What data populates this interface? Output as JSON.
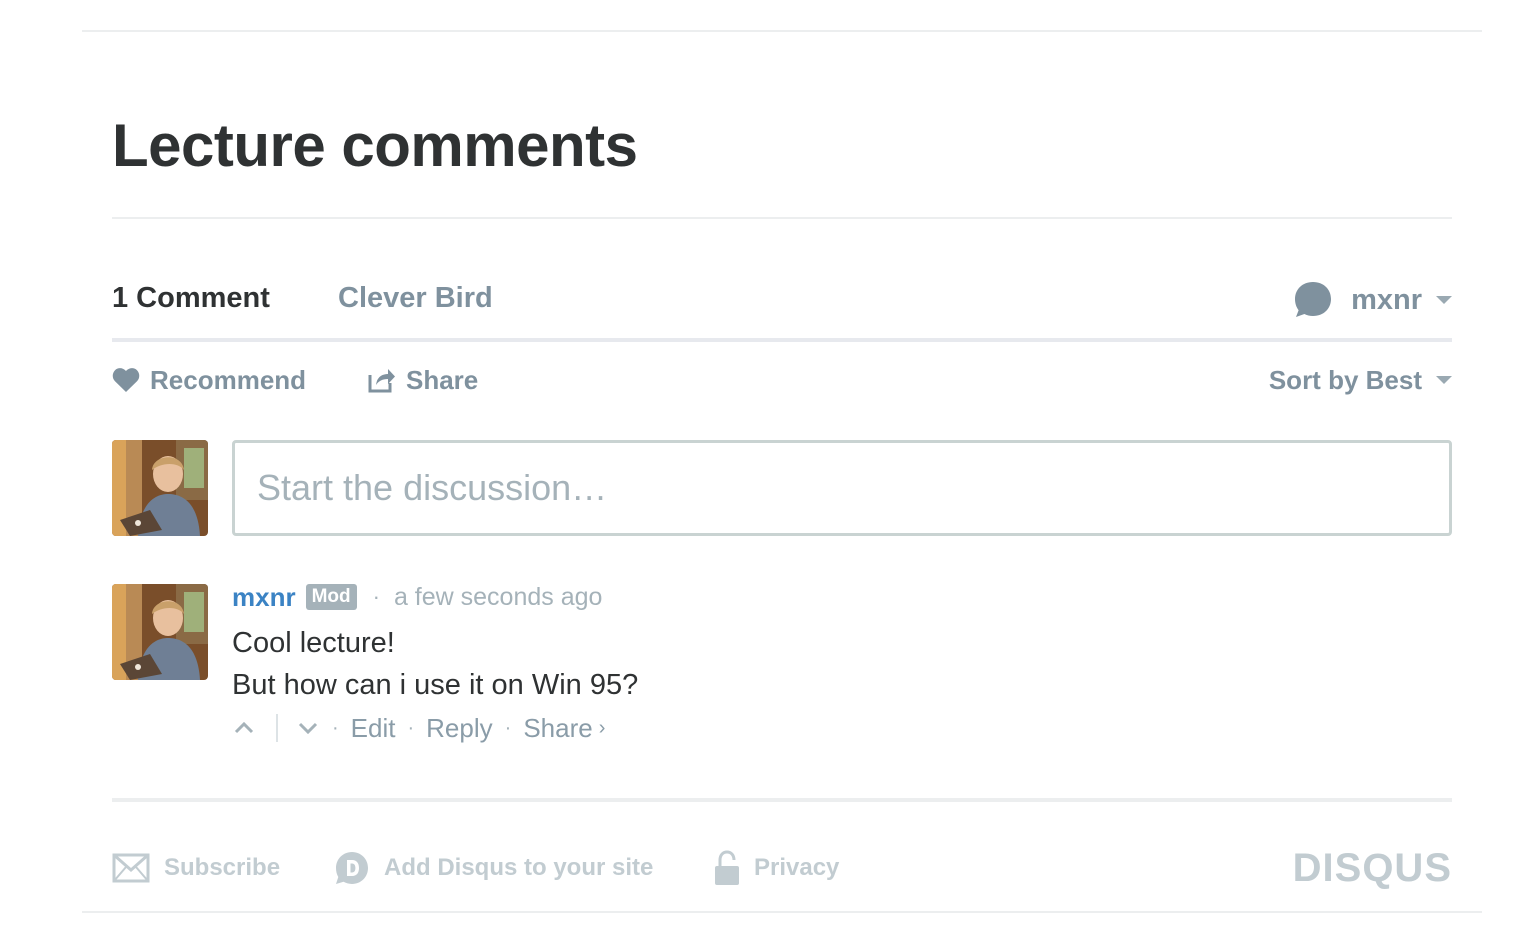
{
  "section_title": "Lecture comments",
  "tabs": {
    "comments_label": "1 Comment",
    "community_label": "Clever Bird",
    "user_name": "mxnr"
  },
  "actions": {
    "recommend_label": "Recommend",
    "share_label": "Share",
    "sort_label": "Sort by Best"
  },
  "composer": {
    "placeholder": "Start the discussion…"
  },
  "comment": {
    "author": "mxnr",
    "badge": "Mod",
    "separator": "·",
    "time": "a few seconds ago",
    "lines": [
      "Cool lecture!",
      "But how can i use it on Win 95?"
    ],
    "edit_label": "Edit",
    "reply_label": "Reply",
    "share_label": "Share",
    "share_arrow": "›"
  },
  "footer": {
    "subscribe_label": "Subscribe",
    "add_disqus_label": "Add Disqus to your site",
    "privacy_label": "Privacy",
    "brand": "DISQUS"
  },
  "colors": {
    "accent_blue": "#2e9fff",
    "author_blue": "#3b83c4",
    "muted": "#7f919e",
    "light_muted": "#a5b2b9",
    "footer_gray": "#c2ccd1"
  },
  "icons": [
    "speech-bubble-icon",
    "heart-icon",
    "share-icon",
    "caret-down-icon",
    "upvote-icon",
    "downvote-icon",
    "envelope-icon",
    "disqus-d-icon",
    "lock-icon"
  ]
}
